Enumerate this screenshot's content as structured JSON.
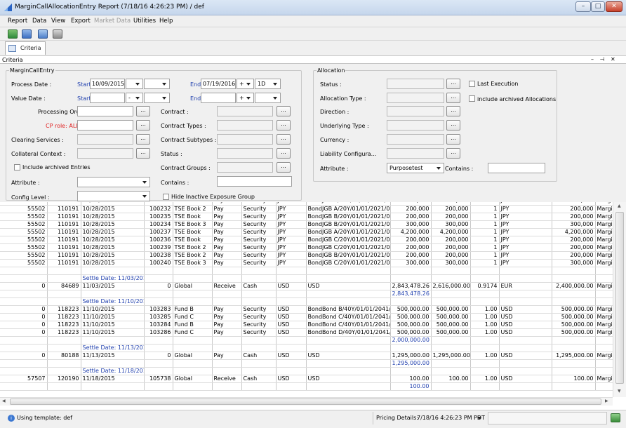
{
  "window": {
    "title": "MarginCallAllocationEntry Report (7/18/16 4:26:23 PM) / def"
  },
  "menu": [
    "Report",
    "Data",
    "View",
    "Export",
    "Market Data",
    "Utilities",
    "Help"
  ],
  "tab": {
    "label": "Criteria"
  },
  "panel": {
    "title": "Criteria",
    "controls": "– ⊣ ✕"
  },
  "mce": {
    "group_label": "MarginCallEntry",
    "process_date_label": "Process Date :",
    "start_label": "Start",
    "start_value": "10/09/2015",
    "end_label": "End",
    "end_value": "07/19/2016",
    "plus_value": "+",
    "period_value": "1D",
    "value_date_label": "Value Date :",
    "value_start_label": "Start",
    "value_minus": "-",
    "value_end_label": "End",
    "value_plus": "+",
    "processing_org_label": "Processing Org",
    "cp_role_label": "CP role: ALL",
    "clearing_label": "Clearing Services :",
    "collateral_label": "Collateral Context :",
    "include_archived_label": "Include archived Entries",
    "attribute_label": "Attribute :",
    "config_label": "Config Level :",
    "contract_label": "Contract :",
    "contract_types_label": "Contract Types :",
    "contract_subtypes_label": "Contract Subtypes :",
    "status_label": "Status :",
    "contract_groups_label": "Contract Groups :",
    "contains_label": "Contains :",
    "hide_inactive_label": "Hide Inactive Exposure Group",
    "ellipsis": "..."
  },
  "alloc": {
    "group_label": "Allocation",
    "status_label": "Status :",
    "type_label": "Allocation Type :",
    "direction_label": "Direction :",
    "underlying_label": "Underlying Type :",
    "currency_label": "Currency :",
    "liability_label": "Liability Configura...",
    "attribute_label": "Attribute :",
    "attribute_value": "Purposetest",
    "contains_label": "Contains :",
    "last_execution_label": "Last Execution",
    "include_archived_label": "include archived Allocations"
  },
  "rows": [
    [
      "55502",
      "110191",
      "10/28/2015",
      "100233",
      "TSE Book 3",
      "Pay",
      "Security",
      "JPY",
      "BondJGB A/20Y/01/01/2021/0%",
      "300,000",
      "300,000",
      "1",
      "JPY",
      "300,000",
      "Margin"
    ],
    [
      "55502",
      "110191",
      "10/28/2015",
      "100232",
      "TSE Book 2",
      "Pay",
      "Security",
      "JPY",
      "BondJGB A/20Y/01/01/2021/0%",
      "200,000",
      "200,000",
      "1",
      "JPY",
      "200,000",
      "Margin"
    ],
    [
      "55502",
      "110191",
      "10/28/2015",
      "100235",
      "TSE Book",
      "Pay",
      "Security",
      "JPY",
      "BondJGB B/20Y/01/01/2021/0%",
      "200,000",
      "200,000",
      "1",
      "JPY",
      "200,000",
      "Margin"
    ],
    [
      "55502",
      "110191",
      "10/28/2015",
      "100234",
      "TSE Book 3",
      "Pay",
      "Security",
      "JPY",
      "BondJGB B/20Y/01/01/2021/0%",
      "300,000",
      "300,000",
      "1",
      "JPY",
      "300,000",
      "Margin"
    ],
    [
      "55502",
      "110191",
      "10/28/2015",
      "100237",
      "TSE Book",
      "Pay",
      "Security",
      "JPY",
      "BondJGB A/20Y/01/01/2021/0%",
      "4,200,000",
      "4,200,000",
      "1",
      "JPY",
      "4,200,000",
      "Margin"
    ],
    [
      "55502",
      "110191",
      "10/28/2015",
      "100236",
      "TSE Book",
      "Pay",
      "Security",
      "JPY",
      "BondJGB C/20Y/01/01/2021/0%",
      "200,000",
      "200,000",
      "1",
      "JPY",
      "200,000",
      "Margin"
    ],
    [
      "55502",
      "110191",
      "10/28/2015",
      "100239",
      "TSE Book 2",
      "Pay",
      "Security",
      "JPY",
      "BondJGB C/20Y/01/01/2021/0%",
      "200,000",
      "200,000",
      "1",
      "JPY",
      "200,000",
      "Margin"
    ],
    [
      "55502",
      "110191",
      "10/28/2015",
      "100238",
      "TSE Book 2",
      "Pay",
      "Security",
      "JPY",
      "BondJGB B/20Y/01/01/2021/0%",
      "200,000",
      "200,000",
      "1",
      "JPY",
      "200,000",
      "Margin"
    ],
    [
      "55502",
      "110191",
      "10/28/2015",
      "100240",
      "TSE Book 3",
      "Pay",
      "Security",
      "JPY",
      "BondJGB C/20Y/01/01/2021/0%",
      "300,000",
      "300,000",
      "1",
      "JPY",
      "300,000",
      "Margin"
    ]
  ],
  "settle1": "Settle Date: 11/03/2015",
  "row_s1": [
    "0",
    "84689",
    "11/03/2015",
    "0",
    "Global",
    "Receive",
    "Cash",
    "USD",
    "USD",
    "2,843,478.26",
    "2,616,000.00",
    "0.9174",
    "EUR",
    "2,400,000.00",
    "Margin"
  ],
  "total_s1": "2,843,478.26",
  "settle2": "Settle Date: 11/10/2015",
  "rows_s2": [
    [
      "0",
      "118223",
      "11/10/2015",
      "103283",
      "Fund B",
      "Pay",
      "Security",
      "USD",
      "BondBond B/40Y/01/01/2041/0%",
      "500,000.00",
      "500,000.00",
      "1.00",
      "USD",
      "500,000.00",
      "Margin"
    ],
    [
      "0",
      "118223",
      "11/10/2015",
      "103285",
      "Fund C",
      "Pay",
      "Security",
      "USD",
      "BondBond C/40Y/01/01/2041/0%",
      "500,000.00",
      "500,000.00",
      "1.00",
      "USD",
      "500,000.00",
      "Margin"
    ],
    [
      "0",
      "118223",
      "11/10/2015",
      "103284",
      "Fund B",
      "Pay",
      "Security",
      "USD",
      "BondBond C/40Y/01/01/2041/0%",
      "500,000.00",
      "500,000.00",
      "1.00",
      "USD",
      "500,000.00",
      "Margin"
    ],
    [
      "0",
      "118223",
      "11/10/2015",
      "103286",
      "Fund C",
      "Pay",
      "Security",
      "USD",
      "BondBond D/40Y/01/01/2041/0%",
      "500,000.00",
      "500,000.00",
      "1.00",
      "USD",
      "500,000.00",
      "Margin"
    ]
  ],
  "total_s2": "2,000,000.00",
  "settle3": "Settle Date: 11/13/2015",
  "row_s3": [
    "0",
    "80188",
    "11/13/2015",
    "0",
    "Global",
    "Pay",
    "Cash",
    "USD",
    "USD",
    "1,295,000.00",
    "1,295,000.00",
    "1.00",
    "USD",
    "1,295,000.00",
    "Margin"
  ],
  "total_s3": "1,295,000.00",
  "settle4": "Settle Date: 11/18/2015",
  "row_s4": [
    "57507",
    "120190",
    "11/18/2015",
    "105738",
    "Global",
    "Receive",
    "Cash",
    "USD",
    "USD",
    "100.00",
    "100.00",
    "1.00",
    "USD",
    "100.00",
    "Margin"
  ],
  "total_s4": "100.00",
  "status": {
    "template": "Using template: def",
    "pricing_label": "Pricing Details:",
    "pricing_value": "7/18/16 4:26:23 PM PDT"
  },
  "colors": {
    "accent_blue": "#1f3fae",
    "cp_role_red": "#e02020"
  }
}
